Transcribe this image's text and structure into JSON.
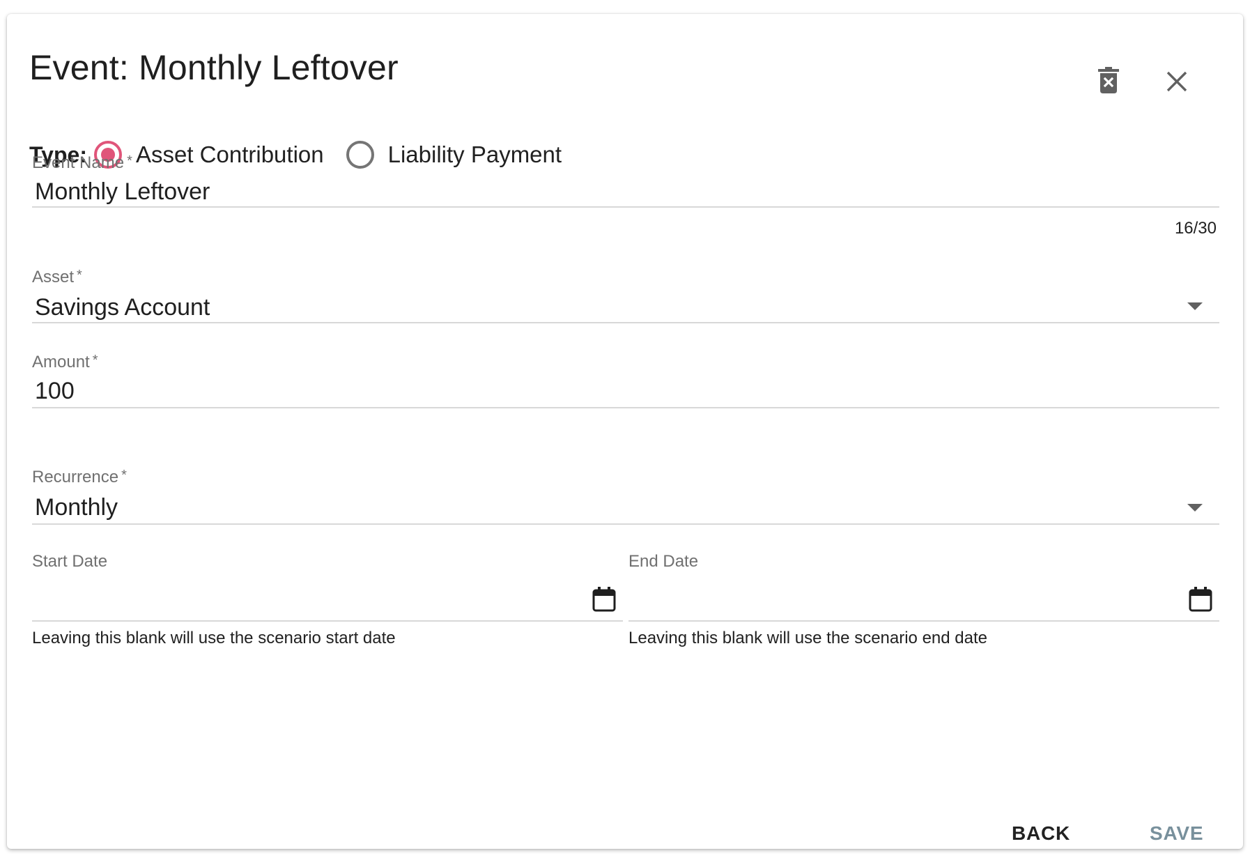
{
  "dialog": {
    "title": "Event: Monthly Leftover",
    "delete_icon": "delete-forever-icon",
    "close_icon": "close-icon"
  },
  "type": {
    "label": "Type:",
    "options": [
      {
        "label": "Asset Contribution",
        "checked": true
      },
      {
        "label": "Liability Payment",
        "checked": false
      }
    ],
    "accent_color": "#e0557a"
  },
  "event_name": {
    "label": "Event Name",
    "required_mark": "*",
    "value": "Monthly Leftover",
    "counter": "16/30"
  },
  "asset": {
    "label": "Asset",
    "required_mark": "*",
    "value": "Savings Account"
  },
  "amount": {
    "label": "Amount",
    "required_mark": "*",
    "value": "100"
  },
  "recurrence": {
    "label": "Recurrence",
    "required_mark": "*",
    "value": "Monthly"
  },
  "start_date": {
    "label": "Start Date",
    "value": "",
    "helper": "Leaving this blank will use the scenario start date",
    "icon": "calendar-icon"
  },
  "end_date": {
    "label": "End Date",
    "value": "",
    "helper": "Leaving this blank will use the scenario end date",
    "icon": "calendar-icon"
  },
  "actions": {
    "back_label": "BACK",
    "save_label": "SAVE"
  }
}
